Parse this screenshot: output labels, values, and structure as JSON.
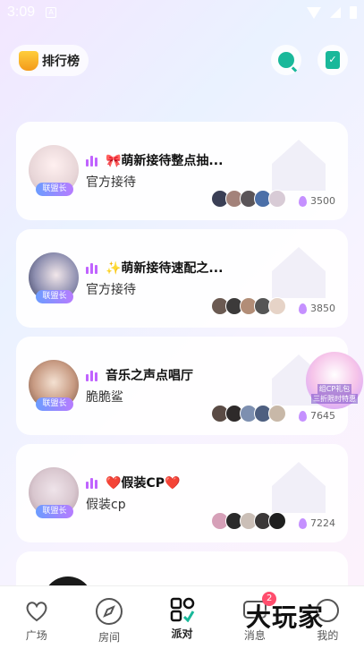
{
  "status": {
    "time": "3:09",
    "notify_icon": "A"
  },
  "header": {
    "rank_label": "排行榜"
  },
  "rooms": [
    {
      "title": "🎀萌新接待整点抽...",
      "subtitle": "官方接待",
      "badge": "联盟长",
      "heat": "3500",
      "avatar_color": "#e8d6d8"
    },
    {
      "title": "✨萌新接待速配之...",
      "subtitle": "官方接待",
      "badge": "联盟长",
      "heat": "3850",
      "avatar_color": "#4a4e6b"
    },
    {
      "title": "音乐之声点唱厅",
      "subtitle": "脆脆鲨",
      "badge": "联盟长",
      "heat": "7645",
      "avatar_color": "#c79a82"
    },
    {
      "title": "❤️假装CP❤️",
      "subtitle": "假装cp",
      "badge": "联盟长",
      "heat": "7224",
      "avatar_color": "#d9c7cf"
    }
  ],
  "promo": {
    "line1": "组CP礼包",
    "line2": "三折限时特惠"
  },
  "tabs": [
    {
      "label": "广场"
    },
    {
      "label": "房间"
    },
    {
      "label": "派对"
    },
    {
      "label": "消息",
      "badge": "2"
    },
    {
      "label": "我的"
    }
  ],
  "watermark": "大玩家",
  "colors": {
    "accent": "#19b89a",
    "voice": "#c063ff",
    "badge_gradient_start": "#6b9cff",
    "badge_gradient_end": "#b77cff"
  }
}
